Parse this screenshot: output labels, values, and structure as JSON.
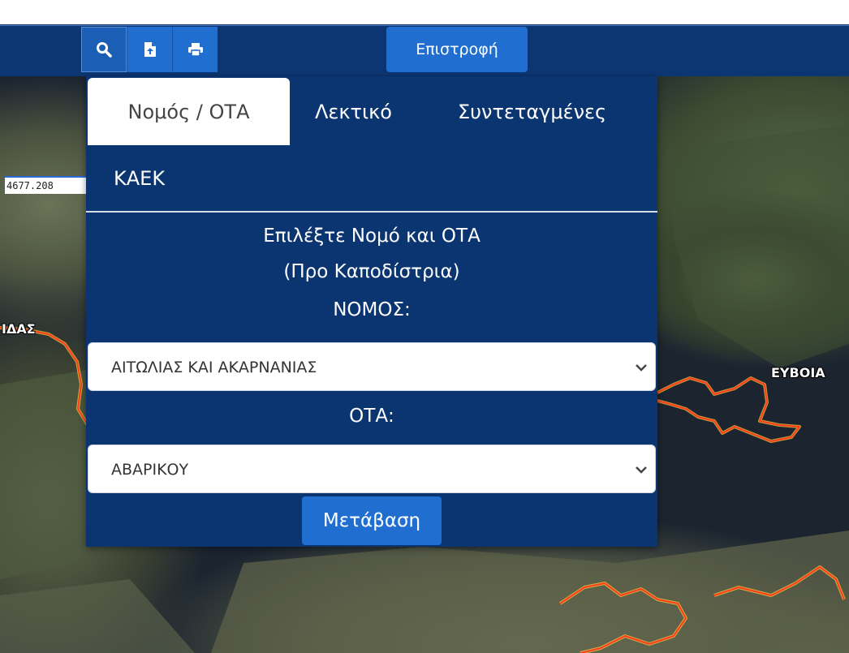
{
  "toolbar": {
    "search_icon": "search-icon",
    "upload_icon": "file-upload-icon",
    "print_icon": "print-icon",
    "return_label": "Επιστροφή"
  },
  "map": {
    "coordinate_readout": "4677.208",
    "labels": {
      "left": "ΙΔΑΣ",
      "right": "ΕΥΒΟΙΑ"
    },
    "boundary_color": "#ff3b1f"
  },
  "search_panel": {
    "tabs": [
      "Νομός / ΟΤΑ",
      "Λεκτικό",
      "Συντεταγμένες",
      "ΚΑΕΚ"
    ],
    "active_tab": "Νομός / ΟΤΑ",
    "instruction_line1": "Επιλέξτε Νομό και ΟΤΑ",
    "instruction_line2": "(Προ Καποδίστρια)",
    "prefecture_label": "ΝΟΜΟΣ:",
    "prefecture_value": "ΑΙΤΩΛΙΑΣ ΚΑΙ ΑΚΑΡΝΑΝΙΑΣ",
    "municipality_label": "ΟΤΑ:",
    "municipality_value": "ΑΒΑΡΙΚΟΥ",
    "go_label": "Μετάβαση"
  },
  "colors": {
    "header_bg": "#0c3673",
    "panel_bg": "#0b3570",
    "button_bg": "#1f6ed0"
  }
}
